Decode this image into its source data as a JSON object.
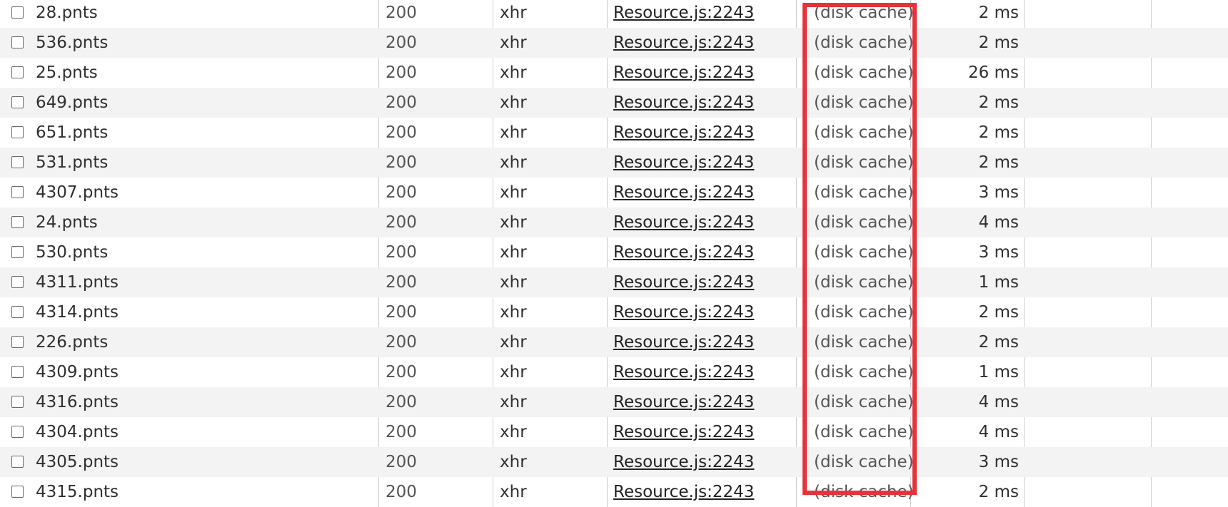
{
  "network": {
    "rows": [
      {
        "name": "28.pnts",
        "status": "200",
        "type": "xhr",
        "initiator": "Resource.js:2243",
        "size": "(disk cache)",
        "time": "2 ms"
      },
      {
        "name": "536.pnts",
        "status": "200",
        "type": "xhr",
        "initiator": "Resource.js:2243",
        "size": "(disk cache)",
        "time": "2 ms"
      },
      {
        "name": "25.pnts",
        "status": "200",
        "type": "xhr",
        "initiator": "Resource.js:2243",
        "size": "(disk cache)",
        "time": "26 ms"
      },
      {
        "name": "649.pnts",
        "status": "200",
        "type": "xhr",
        "initiator": "Resource.js:2243",
        "size": "(disk cache)",
        "time": "2 ms"
      },
      {
        "name": "651.pnts",
        "status": "200",
        "type": "xhr",
        "initiator": "Resource.js:2243",
        "size": "(disk cache)",
        "time": "2 ms"
      },
      {
        "name": "531.pnts",
        "status": "200",
        "type": "xhr",
        "initiator": "Resource.js:2243",
        "size": "(disk cache)",
        "time": "2 ms"
      },
      {
        "name": "4307.pnts",
        "status": "200",
        "type": "xhr",
        "initiator": "Resource.js:2243",
        "size": "(disk cache)",
        "time": "3 ms"
      },
      {
        "name": "24.pnts",
        "status": "200",
        "type": "xhr",
        "initiator": "Resource.js:2243",
        "size": "(disk cache)",
        "time": "4 ms"
      },
      {
        "name": "530.pnts",
        "status": "200",
        "type": "xhr",
        "initiator": "Resource.js:2243",
        "size": "(disk cache)",
        "time": "3 ms"
      },
      {
        "name": "4311.pnts",
        "status": "200",
        "type": "xhr",
        "initiator": "Resource.js:2243",
        "size": "(disk cache)",
        "time": "1 ms"
      },
      {
        "name": "4314.pnts",
        "status": "200",
        "type": "xhr",
        "initiator": "Resource.js:2243",
        "size": "(disk cache)",
        "time": "2 ms"
      },
      {
        "name": "226.pnts",
        "status": "200",
        "type": "xhr",
        "initiator": "Resource.js:2243",
        "size": "(disk cache)",
        "time": "2 ms"
      },
      {
        "name": "4309.pnts",
        "status": "200",
        "type": "xhr",
        "initiator": "Resource.js:2243",
        "size": "(disk cache)",
        "time": "1 ms"
      },
      {
        "name": "4316.pnts",
        "status": "200",
        "type": "xhr",
        "initiator": "Resource.js:2243",
        "size": "(disk cache)",
        "time": "4 ms"
      },
      {
        "name": "4304.pnts",
        "status": "200",
        "type": "xhr",
        "initiator": "Resource.js:2243",
        "size": "(disk cache)",
        "time": "4 ms"
      },
      {
        "name": "4305.pnts",
        "status": "200",
        "type": "xhr",
        "initiator": "Resource.js:2243",
        "size": "(disk cache)",
        "time": "3 ms"
      },
      {
        "name": "4315.pnts",
        "status": "200",
        "type": "xhr",
        "initiator": "Resource.js:2243",
        "size": "(disk cache)",
        "time": "2 ms"
      }
    ]
  },
  "colors": {
    "highlight": "#e8323b",
    "row_alt": "#f3f3f3",
    "divider": "#cfcfcf"
  }
}
